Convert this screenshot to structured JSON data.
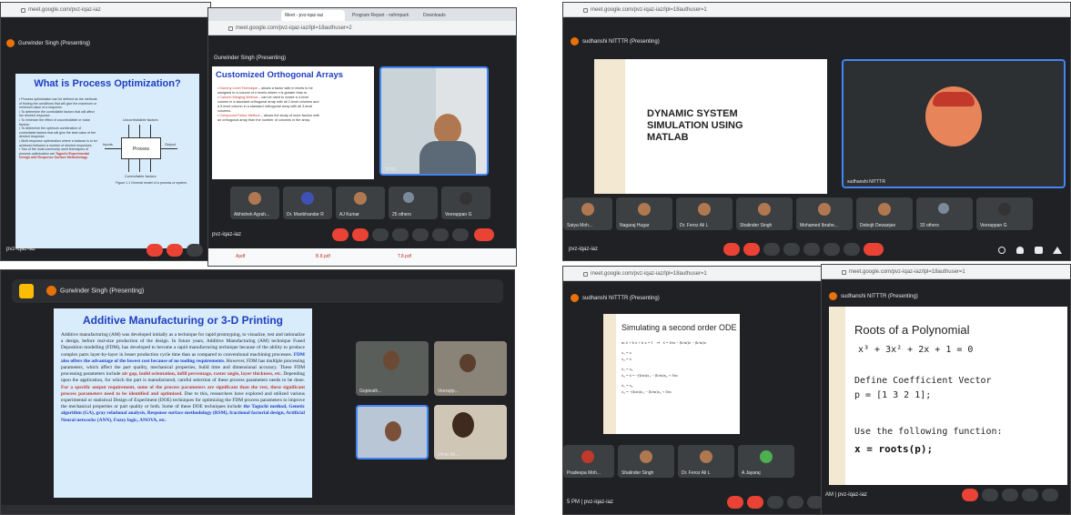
{
  "tl": {
    "url": "meet.google.com/pvz-iqaz-iaz",
    "presenter": "Gurwinder Singh (Presenting)",
    "slide_title": "What is Process Optimization?",
    "diagram_box": "Process",
    "diagram_top": "Uncontrollable factors",
    "diagram_bottom": "Controllable factors",
    "diagram_in": "Inputs",
    "diagram_out": "Output",
    "diagram_caption": "Figure 1.1 General model of a process or system.",
    "methods": "Taguchi Experimental Design and Response Surface Methodology",
    "meet_code": "pvz-iqaz-iaz"
  },
  "tr": {
    "url": "meet.google.com/pvz-iqaz-iaz/lpl=18authuser=2",
    "tabs": [
      "Meet - pvz-iqaz-iaz",
      "Program Report - nsfrmpark",
      "Downloads"
    ],
    "presenter": "Gurwinder Singh (Presenting)",
    "slide_title": "Customized Orthogonal Arrays",
    "items": [
      "Dummy Level Technique",
      "Column Merging Method",
      "Compound Factor Method"
    ],
    "speaker_tile": "Singh",
    "participants": [
      "Abhishek Agrah...",
      "Dr. Manbhandar R",
      "AJ Kumar",
      "25 others",
      "Veerappan G"
    ],
    "meet_code": "pvz-iqaz-iaz",
    "downloads": [
      "Apdf",
      "B.8.pdf",
      "T.8.pdf"
    ]
  },
  "bl": {
    "presenter": "Gurwinder Singh (Presenting)",
    "slide_title": "Additive Manufacturing or 3-D Printing",
    "slide_body": "Additive manufacturing (AM) was developed initially as a technique for rapid prototyping, to visualize, test and rationalize a design, before real-size production of the design. In future years, Additive Manufacturing (AM) technique Fused Deposition modelling (FDM), has developed to become a rapid manufacturing technique because of the ability to produce complex parts layer-by-layer in lesser production cycle time than as compared to conventional machining processes.",
    "tiles": [
      "Gopinath...",
      "Veerapp...",
      "Umar Ah..."
    ]
  },
  "br1": {
    "url": "meet.google.com/pvz-iqaz-iaz/lpl=18authuser=1",
    "presenter": "sudhanshi NITTTR (Presenting)",
    "slide_title": "DYNAMIC SYSTEM SIMULATION USING MATLAB",
    "speaker_tile": "sudhanshi NITTTR",
    "participants": [
      "Satya Moh...",
      "Nagaraj Hugar",
      "Dr. Feroz Ali L",
      "Shalinder Singh",
      "Mohamed Ibrahe...",
      "Debojit Dewanjee",
      "33 others",
      "Veerappan G"
    ],
    "meet_code": "pvz-iqaz-iaz"
  },
  "br2": {
    "url": "meet.google.com/pvz-iqaz-iaz/lpl=18authuser=1",
    "presenter": "sudhanshi NITTTR (Presenting)",
    "slide_title": "Simulating a second order ODE",
    "participants": [
      "Pradeepa Moh...",
      "Shalinder Singh",
      "Dr. Feroz Ali L",
      "A Jayaraj"
    ],
    "meet_code": "pvz-iqaz-iaz",
    "time": "5 PM"
  },
  "br3": {
    "url": "meet.google.com/pvz-iqaz-iaz/lpl=18authuser=1",
    "presenter": "sudhanshi NITTTR (Presenting)",
    "slide_title": "Roots of a Polynomial",
    "equation": "x³ + 3x² + 2x + 1 = 0",
    "define": "Define Coefficient Vector",
    "vector": "p = [1 3 2 1];",
    "use": "Use the following function:",
    "code": "x = roots(p);",
    "meet_code": "pvz-iqaz-iaz",
    "time": "AM"
  },
  "colors": {
    "meet_bg": "#202124",
    "tile": "#3c4043",
    "end_call": "#ea4335",
    "slide_blue": "#1f3fbf",
    "hl_red": "#c0392b"
  }
}
